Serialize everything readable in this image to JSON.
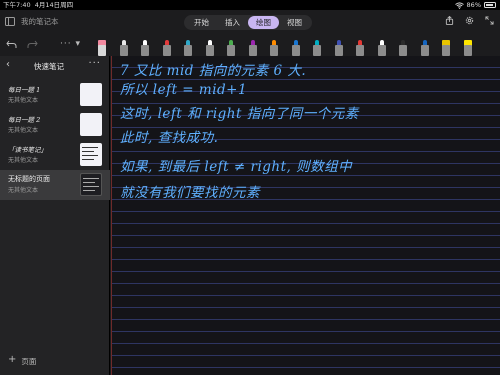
{
  "status": {
    "time": "下午7:40",
    "date": "4月14日周四",
    "battery": "86%",
    "battery_level": 0.86
  },
  "header": {
    "notebook": "我的笔记本",
    "tabs": [
      {
        "label": "开始",
        "active": false
      },
      {
        "label": "插入",
        "active": false
      },
      {
        "label": "绘图",
        "active": true
      },
      {
        "label": "视图",
        "active": false
      }
    ],
    "right_icons": [
      "share-icon",
      "gear-icon",
      "expand-icon"
    ]
  },
  "toolbar": {
    "more": "···",
    "pens": [
      {
        "kind": "eraser",
        "color": "#f28aa0"
      },
      {
        "kind": "pen",
        "color": "#e8e8e8"
      },
      {
        "kind": "pen",
        "color": "#ffffff"
      },
      {
        "kind": "pen",
        "color": "#e23b3b"
      },
      {
        "kind": "pen",
        "color": "#2fa8c8"
      },
      {
        "kind": "pen",
        "color": "#ffffff"
      },
      {
        "kind": "pen",
        "color": "#4caf50"
      },
      {
        "kind": "pen",
        "color": "#9c27b0"
      },
      {
        "kind": "pen",
        "color": "#ff8c00"
      },
      {
        "kind": "pen",
        "color": "#1976d2"
      },
      {
        "kind": "pen",
        "color": "#00acc1"
      },
      {
        "kind": "pen",
        "color": "#3f51b5"
      },
      {
        "kind": "pen",
        "color": "#e53935"
      },
      {
        "kind": "pen",
        "color": "#ffffff"
      },
      {
        "kind": "pen",
        "color": "#2b2b2b"
      },
      {
        "kind": "pen",
        "color": "#1565c0"
      },
      {
        "kind": "hl",
        "color": "#e8c400"
      },
      {
        "kind": "hl",
        "color": "#ffe600"
      }
    ]
  },
  "sidebar": {
    "title": "快速笔记",
    "pages": [
      {
        "title": "每日一题 1",
        "subtitle": "无其他文本",
        "handwritten": true,
        "thumb": "light",
        "selected": false
      },
      {
        "title": "每日一题 2",
        "subtitle": "无其他文本",
        "handwritten": true,
        "thumb": "light",
        "selected": false
      },
      {
        "title": "「读书笔记」",
        "subtitle": "无其他文本",
        "handwritten": true,
        "thumb": "light-text",
        "selected": false
      },
      {
        "title": "无标题的页面",
        "subtitle": "无其他文本",
        "handwritten": false,
        "thumb": "dark",
        "selected": true
      }
    ],
    "add_page": "页面"
  },
  "note": {
    "lines": [
      "7 又比 mid 指向的元素 6 大.",
      "所以 left = mid+1",
      "这时, left 和 right 指向了同一个元素",
      "此时, 查找成功.",
      "如果, 到最后 left ≠ right, 则数组中",
      "就没有我们要找的元素"
    ],
    "ink_color": "#5fb0ff"
  }
}
